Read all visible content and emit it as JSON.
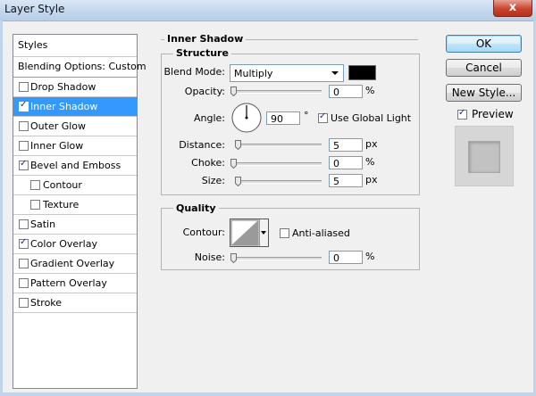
{
  "window": {
    "title": "Layer Style",
    "close_glyph": "x"
  },
  "sidebar": {
    "header": "Styles",
    "blending": "Blending Options: Custom",
    "items": [
      {
        "label": "Drop Shadow",
        "checked": false,
        "selected": false,
        "indent": false
      },
      {
        "label": "Inner Shadow",
        "checked": true,
        "selected": true,
        "indent": false
      },
      {
        "label": "Outer Glow",
        "checked": false,
        "selected": false,
        "indent": false
      },
      {
        "label": "Inner Glow",
        "checked": false,
        "selected": false,
        "indent": false
      },
      {
        "label": "Bevel and Emboss",
        "checked": true,
        "selected": false,
        "indent": false
      },
      {
        "label": "Contour",
        "checked": false,
        "selected": false,
        "indent": true
      },
      {
        "label": "Texture",
        "checked": false,
        "selected": false,
        "indent": true
      },
      {
        "label": "Satin",
        "checked": false,
        "selected": false,
        "indent": false
      },
      {
        "label": "Color Overlay",
        "checked": true,
        "selected": false,
        "indent": false
      },
      {
        "label": "Gradient Overlay",
        "checked": false,
        "selected": false,
        "indent": false
      },
      {
        "label": "Pattern Overlay",
        "checked": false,
        "selected": false,
        "indent": false
      },
      {
        "label": "Stroke",
        "checked": false,
        "selected": false,
        "indent": false
      }
    ]
  },
  "panel": {
    "title": "Inner Shadow",
    "structure": {
      "title": "Structure",
      "blend_mode_label": "Blend Mode:",
      "blend_mode_value": "Multiply",
      "shadow_color": "#000000",
      "opacity_label": "Opacity:",
      "opacity_value": "0",
      "opacity_unit": "%",
      "angle_label": "Angle:",
      "angle_value": "90",
      "angle_unit": "°",
      "global_light_label": "Use Global Light",
      "global_light_checked": true,
      "distance_label": "Distance:",
      "distance_value": "5",
      "distance_unit": "px",
      "choke_label": "Choke:",
      "choke_value": "0",
      "choke_unit": "%",
      "size_label": "Size:",
      "size_value": "5",
      "size_unit": "px"
    },
    "quality": {
      "title": "Quality",
      "contour_label": "Contour:",
      "anti_aliased_label": "Anti-aliased",
      "anti_aliased_checked": false,
      "noise_label": "Noise:",
      "noise_value": "0",
      "noise_unit": "%"
    }
  },
  "buttons": {
    "ok": "OK",
    "cancel": "Cancel",
    "new_style": "New Style...",
    "preview_label": "Preview",
    "preview_checked": true
  }
}
